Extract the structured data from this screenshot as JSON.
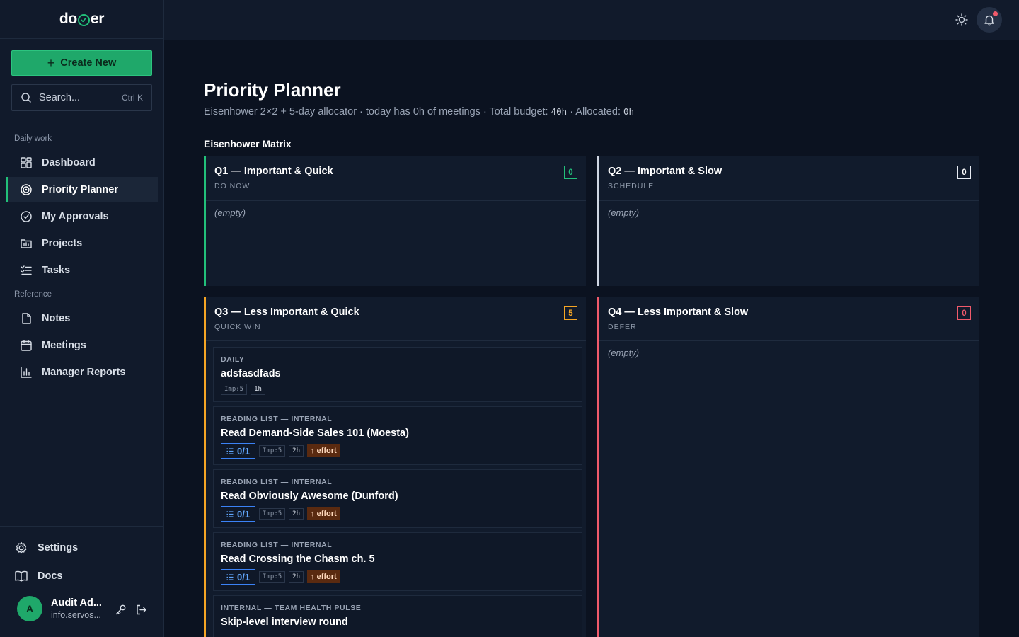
{
  "app": {
    "logo_left": "do",
    "logo_right": "er"
  },
  "sidebar": {
    "create_label": "Create New",
    "search_placeholder": "Search...",
    "search_shortcut": "Ctrl K",
    "sections": [
      {
        "label": "Daily work"
      },
      {
        "label": "Reference"
      }
    ],
    "items": [
      {
        "label": "Dashboard",
        "icon": "dashboard-icon"
      },
      {
        "label": "Priority Planner",
        "icon": "target-icon",
        "active": true
      },
      {
        "label": "My Approvals",
        "icon": "check-circle-icon"
      },
      {
        "label": "Projects",
        "icon": "projects-icon"
      },
      {
        "label": "Tasks",
        "icon": "tasks-icon"
      },
      {
        "label": "Notes",
        "icon": "note-icon"
      },
      {
        "label": "Meetings",
        "icon": "calendar-icon"
      },
      {
        "label": "Manager Reports",
        "icon": "bar-chart-icon"
      }
    ],
    "bottom": {
      "settings_label": "Settings",
      "docs_label": "Docs"
    },
    "user": {
      "initial": "A",
      "name": "Audit Ad...",
      "email": "info.servos..."
    }
  },
  "page": {
    "title": "Priority Planner",
    "subtitle_prefix": "Eisenhower 2×2 + 5-day allocator · today has 0h of meetings · Total budget: ",
    "total_budget": "40h",
    "allocated_label": " · Allocated: ",
    "allocated": "0h",
    "matrix_title": "Eisenhower Matrix"
  },
  "quadrants": [
    {
      "title": "Q1 — Important & Quick",
      "subtitle": "DO NOW",
      "count": "0",
      "color": "#22c07a",
      "empty_label": "(empty)"
    },
    {
      "title": "Q2 — Important & Slow",
      "subtitle": "SCHEDULE",
      "count": "0",
      "color": "#cfd6e2",
      "empty_label": "(empty)"
    },
    {
      "title": "Q3 — Less Important & Quick",
      "subtitle": "QUICK WIN",
      "count": "5",
      "color": "#f5a524"
    },
    {
      "title": "Q4 — Less Important & Slow",
      "subtitle": "DEFER",
      "count": "0",
      "color": "#f05a6b",
      "empty_label": "(empty)"
    }
  ],
  "q3_cards": [
    {
      "category": "DAILY",
      "title": "adsfasdfads",
      "importance": "Imp:5",
      "duration": "1h"
    },
    {
      "category": "READING LIST — INTERNAL",
      "title": "Read Demand-Side Sales 101 (Moesta)",
      "checklist": "0/1",
      "importance": "Imp:5",
      "duration": "2h",
      "effort": "↑ effort"
    },
    {
      "category": "READING LIST — INTERNAL",
      "title": "Read Obviously Awesome (Dunford)",
      "checklist": "0/1",
      "importance": "Imp:5",
      "duration": "2h",
      "effort": "↑ effort"
    },
    {
      "category": "READING LIST — INTERNAL",
      "title": "Read Crossing the Chasm ch. 5",
      "checklist": "0/1",
      "importance": "Imp:5",
      "duration": "2h",
      "effort": "↑ effort"
    },
    {
      "category": "INTERNAL — TEAM HEALTH PULSE",
      "title": "Skip-level interview round"
    }
  ]
}
